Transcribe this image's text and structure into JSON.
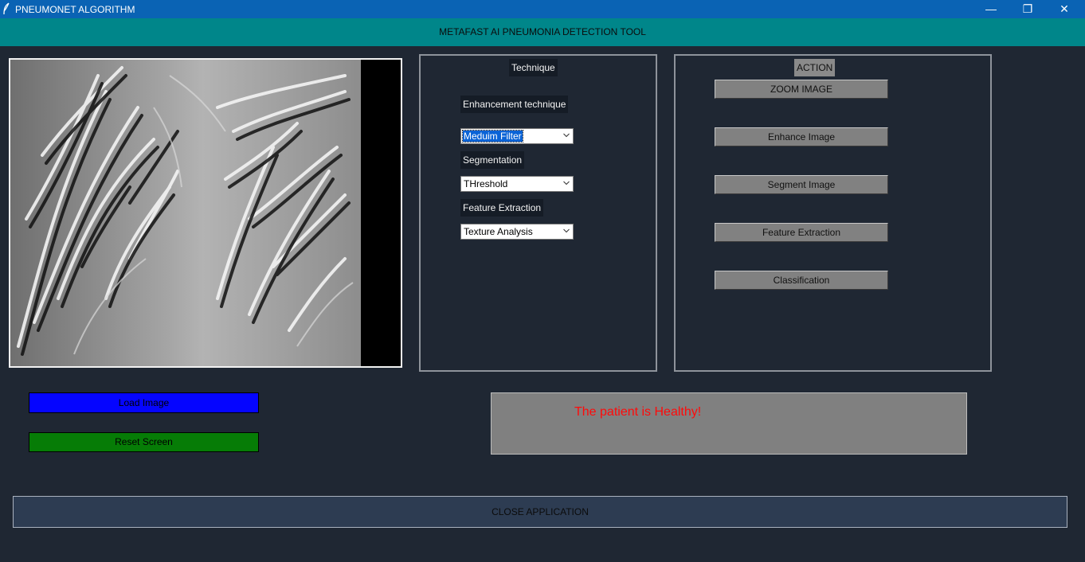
{
  "window": {
    "title": "PNEUMONET ALGORITHM",
    "icon": "feather-icon",
    "controls": {
      "minimize": "—",
      "maximize": "❐",
      "close": "✕"
    }
  },
  "header": {
    "title": "METAFAST AI PNEUMONIA DETECTION TOOL"
  },
  "image_view": {
    "image": "chest-xray-enhanced-image"
  },
  "technique_panel": {
    "heading": "Technique",
    "enhancement": {
      "label": "Enhancement technique",
      "selected": "Meduim Filter"
    },
    "segmentation": {
      "label": "Segmentation",
      "selected": "THreshold"
    },
    "feature_extraction": {
      "label": "Feature Extraction",
      "selected": "Texture Analysis"
    }
  },
  "action_panel": {
    "heading": "ACTION",
    "buttons": {
      "zoom": "ZOOM IMAGE",
      "enhance": "Enhance Image",
      "segment": "Segment Image",
      "feature": "Feature Extraction",
      "classify": "Classification"
    }
  },
  "left_buttons": {
    "load": "Load Image",
    "reset": "Reset Screen"
  },
  "result": {
    "message": "The patient is Healthy!",
    "color": "#ff0a0a"
  },
  "footer": {
    "close": "CLOSE APPLICATION"
  },
  "colors": {
    "titlebar": "#0a63b4",
    "header": "#00868a",
    "background": "#1f2733",
    "load_button": "#0505ff",
    "reset_button": "#067c06",
    "action_button": "#818181",
    "close_button": "#2d3c52"
  }
}
